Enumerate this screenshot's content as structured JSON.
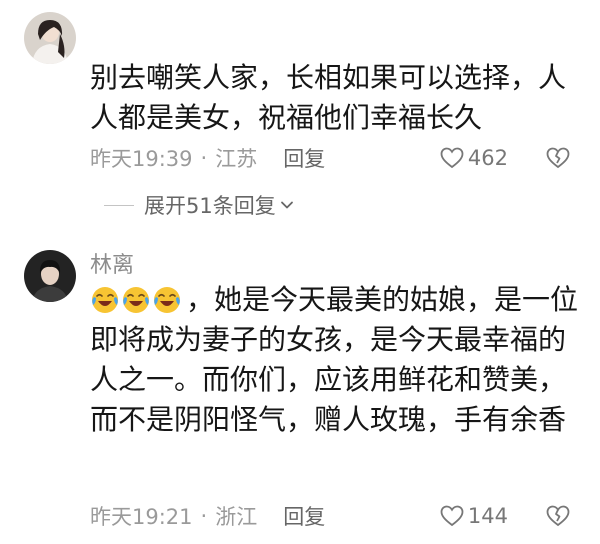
{
  "comments": [
    {
      "avatar_icon": "user-avatar-woman-icon",
      "body": "别去嘲笑人家，长相如果可以选择，人人都是美女，祝福他们幸福长久",
      "time": "昨天19:39",
      "location": "江苏",
      "reply_label": "回复",
      "likes": "462",
      "expand_label": "展开51条回复"
    },
    {
      "avatar_icon": "user-avatar-man-icon",
      "username": "林离",
      "emoji": [
        "laugh-cry-emoji",
        "laugh-cry-emoji",
        "laugh-cry-emoji"
      ],
      "body": "，她是今天最美的姑娘，是一位即将成为妻子的女孩，是今天最幸福的人之一。而你们，应该用鲜花和赞美，而不是阴阳怪气，赠人玫瑰，手有余香",
      "time": "昨天19:21",
      "location": "浙江",
      "reply_label": "回复",
      "likes": "144"
    }
  ],
  "separator": "·",
  "colors": {
    "text": "#161616",
    "meta": "#9a9a9a",
    "background": "#ffffff"
  }
}
